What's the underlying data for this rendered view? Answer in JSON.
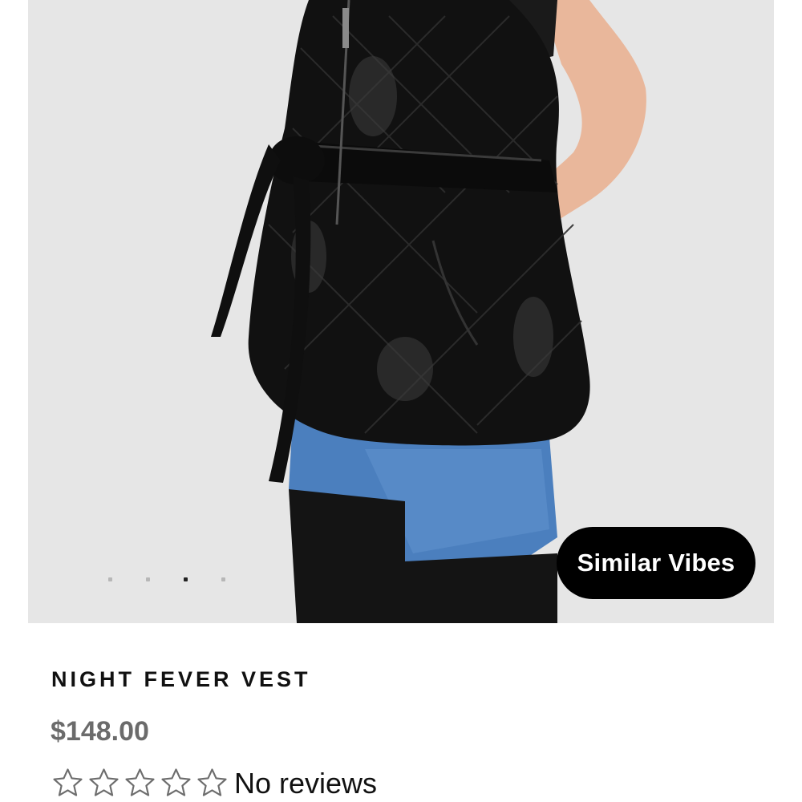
{
  "product": {
    "title": "NIGHT FEVER VEST",
    "price": "$148.00",
    "reviews_text": "No reviews",
    "rating": {
      "value": 0,
      "max": 5
    }
  },
  "gallery": {
    "dot_count": 4,
    "active_dot": 3,
    "similar_button_label": "Similar Vibes"
  },
  "icons": {
    "star": "star-outline-icon"
  },
  "colors": {
    "button_bg": "#000000",
    "price": "#6b6b6b",
    "image_bg": "#e7e7e7"
  }
}
